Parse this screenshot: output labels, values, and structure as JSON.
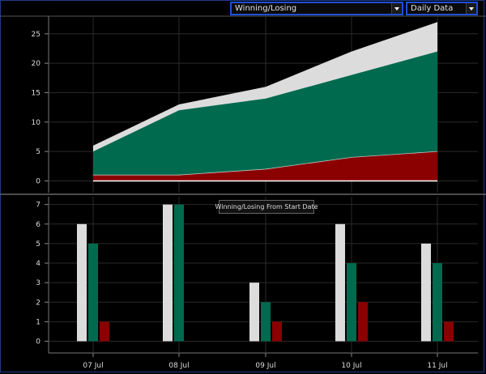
{
  "toolbar": {
    "metric_select": {
      "value": "Winning/Losing"
    },
    "period_select": {
      "value": "Daily Data"
    }
  },
  "tooltip": "Winning/Losing From Start Date",
  "colors": {
    "white": "#dcdcdc",
    "green": "#006a4e",
    "red": "#8b0000",
    "grid": "#2a2a2a"
  },
  "chart_data": [
    {
      "type": "area",
      "categories": [
        "07 Jul",
        "08 Jul",
        "09 Jul",
        "10 Jul",
        "11 Jul"
      ],
      "series": [
        {
          "color": "#8b0000",
          "values": [
            1,
            1,
            2,
            4,
            5
          ]
        },
        {
          "color": "#006a4e",
          "values": [
            5,
            12,
            14,
            18,
            22
          ]
        },
        {
          "color": "#dcdcdc",
          "values": [
            6,
            13,
            16,
            22,
            27
          ]
        }
      ],
      "ylim": [
        -2,
        28
      ],
      "yticks": [
        0,
        5,
        10,
        15,
        20,
        25
      ],
      "grid": true
    },
    {
      "type": "bar",
      "categories": [
        "07 Jul",
        "08 Jul",
        "09 Jul",
        "10 Jul",
        "11 Jul"
      ],
      "series": [
        {
          "color": "#dcdcdc",
          "values": [
            6,
            7,
            3,
            6,
            5
          ]
        },
        {
          "color": "#006a4e",
          "values": [
            5,
            7,
            2,
            4,
            4
          ]
        },
        {
          "color": "#8b0000",
          "values": [
            1,
            0,
            1,
            2,
            1
          ]
        }
      ],
      "ylim": [
        -0.6,
        7.4
      ],
      "yticks": [
        0,
        1,
        2,
        3,
        4,
        5,
        6,
        7
      ],
      "grid": true
    }
  ]
}
